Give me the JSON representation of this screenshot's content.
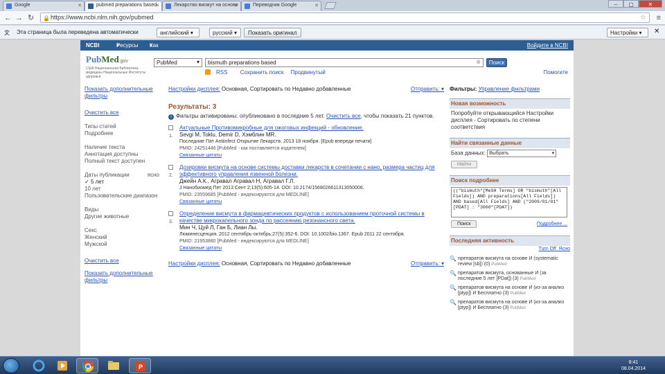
{
  "browser": {
    "tabs": [
      {
        "label": "Google"
      },
      {
        "label": "pubmed preparations based"
      },
      {
        "label": "Лекарство висмут на основе"
      },
      {
        "label": "Переводчик Google"
      }
    ],
    "url": "https://www.ncbi.nlm.nih.gov/pubmed"
  },
  "translate_bar": {
    "message": "Эта страница была переведена автоматически",
    "from_lang": "английский",
    "to_lang": "русский",
    "show_original": "Показать оригинал",
    "settings": "Настройки"
  },
  "ncbi": {
    "brand": "NCBI",
    "resources": "Ресурсы",
    "how_to": "Как",
    "sign_in": "Войдите в NCBI"
  },
  "logo": {
    "pub": "Pub",
    "med": "Med",
    "gov": ".gov",
    "subtitle": "США Национальная Библиотека медицины Национальные Институты здоровья"
  },
  "search": {
    "database": "PubMed",
    "query": "bismuth preparations based",
    "button": "Поиск",
    "rss": "RSS",
    "save": "Сохранить поиск",
    "advanced": "Продвинутый",
    "help": "Помогите"
  },
  "left": {
    "show_more": "Показать дополнительные фильтры",
    "clear": "Очистить все",
    "types_label": "Типы статей",
    "types_more": "Подробнее",
    "avail_label": "Наличие текста",
    "avail_1": "Аннотация доступны",
    "avail_2": "Полный текст доступен",
    "dates_label": "Даты публикации",
    "dates_clear": "ясно",
    "date_1": "5 лет",
    "date_2": "10 лет",
    "date_3": "Пользовательские диапазон",
    "species_label": "Виды",
    "species_1": "Другие животные",
    "sex_label": "Секс",
    "sex_1": "Женский",
    "sex_2": "Мужской",
    "clear2": "Очистить все",
    "show_more2": "Показать дополнительные фильтры"
  },
  "center": {
    "display_settings": "Настройки дисплея:",
    "display_value": "Основная, Сортировать по Недавно добавленные",
    "send_to": "Отправить:",
    "results": "Результаты: 3",
    "filter_note": "Фильтры активированы: опубликовано в последние 5 лет.",
    "filter_clear": "Очистить все",
    "filter_note_2": ", чтобы показать 21 пунктов.",
    "items": [
      {
        "num": "1.",
        "title": "Актуальные Противомикробные для ожоговых инфекций - обновление.",
        "authors": "Sevgi M, Toklu, Demir D, Хэмблин MR.",
        "journal": "Последние Пат Antiinfect Открытие Лекарств. 2013 18 ноября. [Epub впереди печати]",
        "pmid": "PMID: 24251446 [PubMed - как поставляется издателем]",
        "related": "Связанные цитаты"
      },
      {
        "num": "2.",
        "title": "Дозировки висмута на основе системы доставки лекарств в сочетании с нано, размера частиц для эффективного управления язвенной болезни.",
        "authors": "Джейн А.К., Агравал Агравал Н, Агравал Г.Л.",
        "journal": "J Нанобиомед Пет 2013 Сент 2;13(5):605-14. DOI: 10.2174/1568026611313050006.",
        "pmid": "PMID: 23559685 [PubMed - индексируются для MEDLINE]",
        "related": "Связанные цитаты"
      },
      {
        "num": "3.",
        "title": "Определение висмута в фармацевтических продуктов с использованием проточной системы в качестве микрокапельного зонда по рассеянию резонансного света.",
        "authors": "Мин Ч, Цуй Л, Ган Б, Лиан Лы.",
        "journal": "Люминесценция. 2012 сентябрь-октябрь;27(5):352-6. DOI: 10.1002/bio.1367. Epub 2011 22 сентября.",
        "pmid": "PMID: 21953880 [PubMed - индексируются для MEDLINE]",
        "related": "Связанные цитаты"
      }
    ]
  },
  "right": {
    "filters_label": "Фильтры:",
    "manage_filters": "Управление фильтрами",
    "new_header": "Новая возможность",
    "new_body": "Попробуйте открывающийся Настройки дисплея - Сортировать по степени соответствия",
    "related_header": "Найти связанные данные",
    "db_label": "База данных:",
    "db_value": "Выбрать",
    "find_btn": "Найти",
    "adv_header": "Поиск подробнее",
    "adv_query": "((\"bismuth\"[MeSH Terms] OR \"bismuth\"[All Fields]) AND preparations[All Fields]) AND based[All Fields] AND (\"2009/01/01\"[PDAT] : \"3000\"[PDAT])",
    "search_btn": "Поиск",
    "more": "Подробнее ...",
    "recent_header": "Последняя активность",
    "turn_off": "Turn Off",
    "clear": "Ясно",
    "activities": [
      {
        "text": "препаратов висмута на основе И (systematic review [sb]) (0)",
        "db": "PubMed"
      },
      {
        "text": "препаратов висмута, основанные И (за последние 5 лет [PDat]) (3)",
        "db": "PubMed"
      },
      {
        "text": "препаратов висмута на основе И (из-за анализ [ptyp]) И Бесплатно (3)",
        "db": "PubMed"
      },
      {
        "text": "препаратов висмута на основе И (из-за анализ [ptyp]) И Бесплатно (3)",
        "db": "PubMed"
      }
    ]
  },
  "taskbar": {
    "time": "8:41",
    "date": "08.04.2014"
  }
}
